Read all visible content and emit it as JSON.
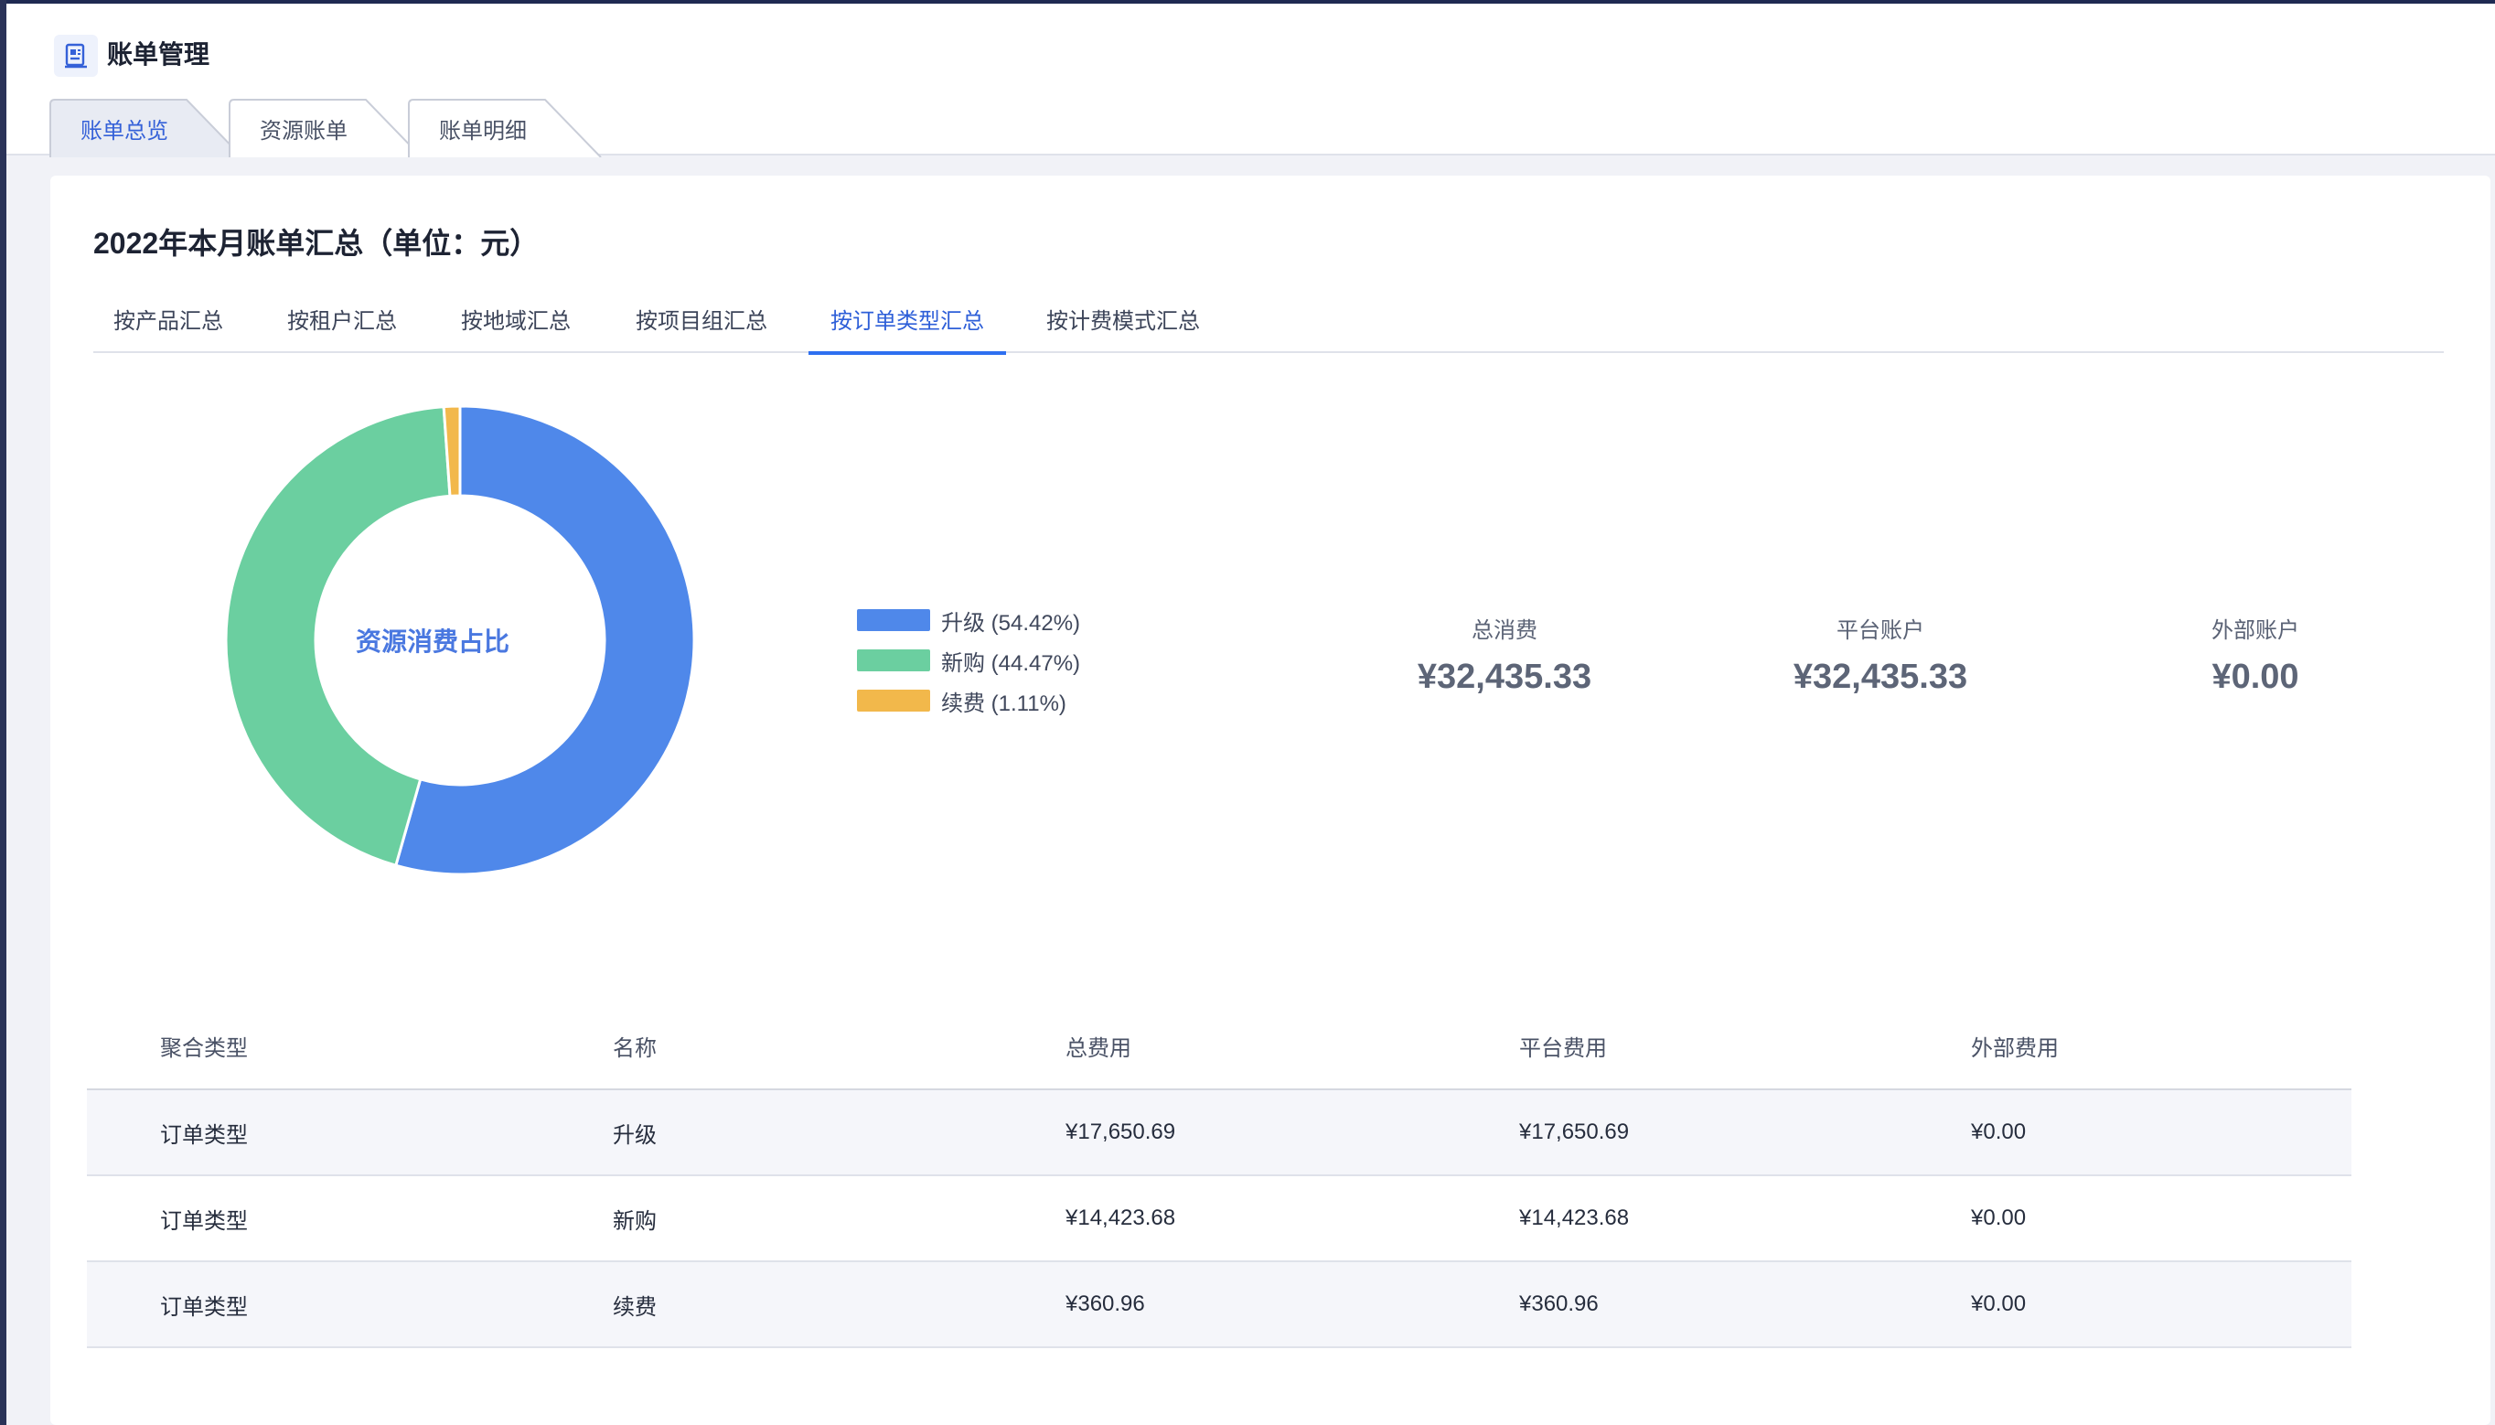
{
  "app": {
    "title": "账单管理",
    "logo_icon": "bill-document-icon"
  },
  "page_tabs": [
    {
      "label": "账单总览",
      "active": true
    },
    {
      "label": "资源账单",
      "active": false
    },
    {
      "label": "账单明细",
      "active": false
    }
  ],
  "summary": {
    "title": "2022年本月账单汇总（单位：元）",
    "sub_tabs": [
      {
        "label": "按产品汇总",
        "active": false
      },
      {
        "label": "按租户汇总",
        "active": false
      },
      {
        "label": "按地域汇总",
        "active": false
      },
      {
        "label": "按项目组汇总",
        "active": false
      },
      {
        "label": "按订单类型汇总",
        "active": true
      },
      {
        "label": "按计费模式汇总",
        "active": false
      }
    ]
  },
  "chart_data": {
    "type": "pie",
    "center_label": "资源消费占比",
    "categories": [
      "升级",
      "新购",
      "续费"
    ],
    "values": [
      54.42,
      44.47,
      1.11
    ],
    "legend": [
      "升级 (54.42%)",
      "新购 (44.47%)",
      "续费 (1.11%)"
    ],
    "colors": [
      "#4f88ea",
      "#6bcfa0",
      "#f2b84b"
    ],
    "legend_position": "top-right"
  },
  "stats": [
    {
      "label": "总消费",
      "value": "¥32,435.33"
    },
    {
      "label": "平台账户",
      "value": "¥32,435.33"
    },
    {
      "label": "外部账户",
      "value": "¥0.00"
    }
  ],
  "table": {
    "headers": [
      "聚合类型",
      "名称",
      "总费用",
      "平台费用",
      "外部费用"
    ],
    "rows": [
      [
        "订单类型",
        "升级",
        "¥17,650.69",
        "¥17,650.69",
        "¥0.00"
      ],
      [
        "订单类型",
        "新购",
        "¥14,423.68",
        "¥14,423.68",
        "¥0.00"
      ],
      [
        "订单类型",
        "续费",
        "¥360.96",
        "¥360.96",
        "¥0.00"
      ]
    ]
  }
}
